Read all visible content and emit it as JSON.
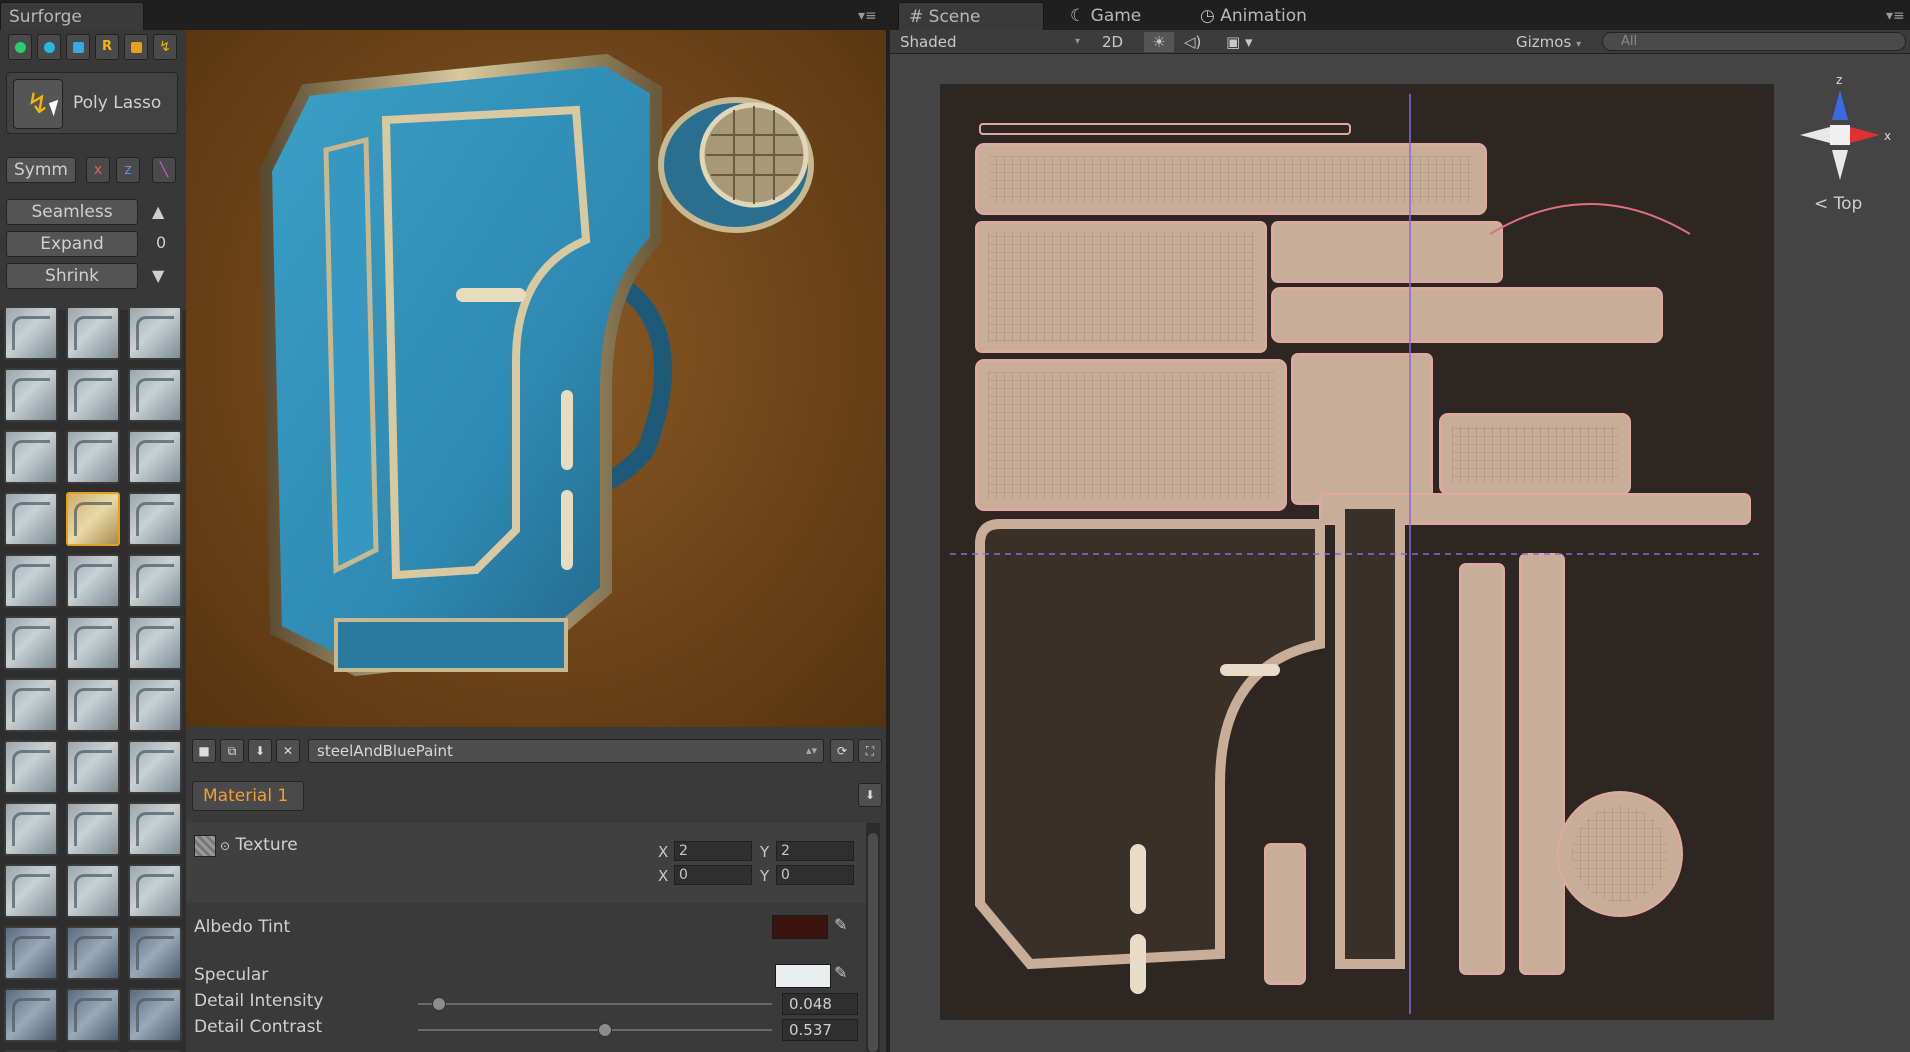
{
  "left_window": {
    "title": "Surforge",
    "tool_name": "Poly Lasso",
    "symm_label": "Symm",
    "axis_x": "x",
    "axis_z": "z",
    "seamless_label": "Seamless",
    "expand_label": "Expand",
    "expand_value": "0",
    "shrink_label": "Shrink",
    "color_buttons": [
      "#28d06a",
      "#2bb8e0",
      "#3aa8e8",
      "R",
      "#e8a020",
      "#e8b800"
    ]
  },
  "material": {
    "selected_material": "steelAndBluePaint",
    "tab_label": "Material 1",
    "texture_label": "Texture",
    "tiling_x": "2",
    "tiling_y": "2",
    "offset_x": "0",
    "offset_y": "0",
    "x_label": "X",
    "y_label": "Y",
    "albedo_tint_label": "Albedo Tint",
    "albedo_tint_color": "#3a140c",
    "specular_label": "Specular",
    "specular_color": "#e8eeee",
    "detail_intensity_label": "Detail Intensity",
    "detail_intensity_value": "0.048",
    "detail_contrast_label": "Detail Contrast",
    "detail_contrast_value": "0.537"
  },
  "scene_window": {
    "tab_scene": "Scene",
    "tab_game": "Game",
    "tab_animation": "Animation",
    "shading_mode": "Shaded",
    "mode_2d": "2D",
    "gizmos_label": "Gizmos",
    "search_placeholder": "All",
    "view_label": "Top",
    "axis_z_label": "z",
    "axis_x_label": "x"
  }
}
